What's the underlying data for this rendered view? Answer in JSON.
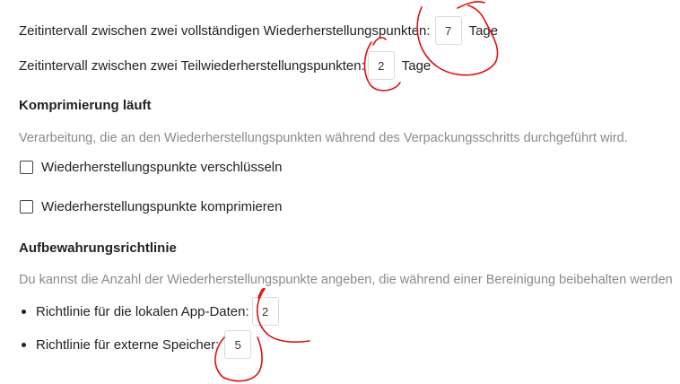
{
  "backup": {
    "full_interval_label": "Zeitintervall zwischen zwei vollständigen Wiederherstellungspunkten:",
    "full_interval_value": "7",
    "full_interval_unit": "Tage",
    "partial_interval_label": "Zeitintervall zwischen zwei Teilwiederherstellungspunkten:",
    "partial_interval_value": "2",
    "partial_interval_unit": "Tage"
  },
  "compression": {
    "heading": "Komprimierung läuft",
    "description": "Verarbeitung, die an den Wiederherstellungspunkten während des Verpackungsschritts durchgeführt wird.",
    "encrypt_label": "Wiederherstellungspunkte verschlüsseln",
    "encrypt_checked": false,
    "compress_label": "Wiederherstellungspunkte komprimieren",
    "compress_checked": false
  },
  "retention": {
    "heading": "Aufbewahrungsrichtlinie",
    "description": "Du kannst die Anzahl der Wiederherstellungspunkte angeben, die während einer Bereinigung beibehalten werden",
    "local_label": "Richtlinie für die lokalen App-Daten:",
    "local_value": "2",
    "external_label": "Richtlinie für externe Speicher:",
    "external_value": "5"
  },
  "colors": {
    "annotation": "#e01010",
    "description_text": "#8a8a8a"
  }
}
